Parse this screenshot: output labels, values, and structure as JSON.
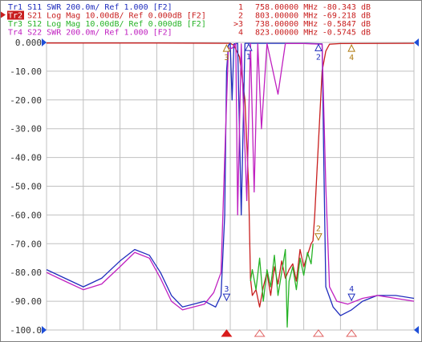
{
  "traces": [
    {
      "label": "Tr1 S11 SWR 200.0m/ Ref 1.000 [F2]",
      "color": "#1f2dbd",
      "active": false
    },
    {
      "label": "Tr2 S21 Log Mag 10.00dB/ Ref 0.000dB [F2]",
      "color": "#c81e1e",
      "active": true
    },
    {
      "label": "Tr3 S12 Log Mag 10.00dB/ Ref 0.000dB [F2]",
      "color": "#27b327",
      "active": false
    },
    {
      "label": "Tr4 S22 SWR 200.0m/ Ref 1.000 [F2]",
      "color": "#c020c0",
      "active": false
    }
  ],
  "marker_table": [
    {
      "id": "1",
      "prefix": "",
      "freq": "758.00000 MHz",
      "value": "-80.343 dB"
    },
    {
      "id": "2",
      "prefix": "",
      "freq": "803.00000 MHz",
      "value": "-69.218 dB"
    },
    {
      "id": "3",
      "prefix": ">",
      "freq": "738.00000 MHz",
      "value": "-0.5847 dB"
    },
    {
      "id": "4",
      "prefix": "",
      "freq": "823.00000 MHz",
      "value": "-0.5745 dB"
    }
  ],
  "colors": {
    "marker_text": "#c81e1e",
    "grid": "#c0c0c0",
    "ref_arrow": "#1f4fd8",
    "stimulus_marker": "#d81b1b",
    "marker_outline": "#e06060"
  },
  "icons": [
    "reference-level-arrow-icon",
    "stimulus-marker-arrow-icon",
    "trace-marker-triangle-icon"
  ],
  "chart_data": {
    "type": "line",
    "ylim": [
      -100,
      0
    ],
    "y_ticks": [
      "0.000",
      "-10.00",
      "-20.00",
      "-30.00",
      "-40.00",
      "-50.00",
      "-60.00",
      "-70.00",
      "-80.00",
      "-90.00",
      "-100.0"
    ],
    "x_divisions": 10,
    "grid": true,
    "legend": "top-left",
    "series": [
      {
        "name": "S21",
        "color": "#c81e1e",
        "points": [
          [
            0,
            -0.2
          ],
          [
            3,
            -0.2
          ],
          [
            5,
            -0.3
          ],
          [
            5.1,
            -1
          ],
          [
            5.25,
            -5
          ],
          [
            5.4,
            -20
          ],
          [
            5.5,
            -50
          ],
          [
            5.55,
            -82
          ],
          [
            5.6,
            -88
          ],
          [
            5.7,
            -86
          ],
          [
            5.8,
            -92
          ],
          [
            5.9,
            -85
          ],
          [
            6,
            -80
          ],
          [
            6.1,
            -88
          ],
          [
            6.2,
            -78
          ],
          [
            6.3,
            -84
          ],
          [
            6.4,
            -76
          ],
          [
            6.5,
            -82
          ],
          [
            6.6,
            -79
          ],
          [
            6.7,
            -77
          ],
          [
            6.8,
            -83
          ],
          [
            6.9,
            -72
          ],
          [
            7,
            -78
          ],
          [
            7.1,
            -74
          ],
          [
            7.2,
            -70
          ],
          [
            7.25,
            -69
          ],
          [
            7.3,
            -60
          ],
          [
            7.4,
            -35
          ],
          [
            7.5,
            -10
          ],
          [
            7.6,
            -3
          ],
          [
            7.7,
            -0.6
          ],
          [
            8,
            -0.4
          ],
          [
            10,
            -0.3
          ]
        ]
      },
      {
        "name": "S12",
        "color": "#27b327",
        "points": [
          [
            5.55,
            -83
          ],
          [
            5.6,
            -79
          ],
          [
            5.7,
            -86
          ],
          [
            5.8,
            -75
          ],
          [
            5.9,
            -90
          ],
          [
            6,
            -79
          ],
          [
            6.1,
            -85
          ],
          [
            6.2,
            -74
          ],
          [
            6.3,
            -88
          ],
          [
            6.4,
            -80
          ],
          [
            6.5,
            -72
          ],
          [
            6.55,
            -99
          ],
          [
            6.6,
            -83
          ],
          [
            6.7,
            -78
          ],
          [
            6.8,
            -86
          ],
          [
            6.9,
            -75
          ],
          [
            7,
            -81
          ],
          [
            7.1,
            -73
          ],
          [
            7.2,
            -77
          ],
          [
            7.25,
            -70
          ]
        ]
      },
      {
        "name": "S11",
        "color": "#1f2dbd",
        "points": [
          [
            0,
            -79
          ],
          [
            0.5,
            -82
          ],
          [
            1,
            -85
          ],
          [
            1.5,
            -82
          ],
          [
            2,
            -76
          ],
          [
            2.4,
            -72
          ],
          [
            2.8,
            -74
          ],
          [
            3.1,
            -80
          ],
          [
            3.4,
            -88
          ],
          [
            3.7,
            -92
          ],
          [
            4,
            -91
          ],
          [
            4.3,
            -90
          ],
          [
            4.6,
            -92
          ],
          [
            4.75,
            -88
          ],
          [
            4.85,
            -60
          ],
          [
            4.9,
            -10
          ],
          [
            4.95,
            -1
          ],
          [
            5,
            -0.3
          ],
          [
            5.05,
            -20
          ],
          [
            5.1,
            -0.5
          ],
          [
            5.2,
            -0.3
          ],
          [
            5.3,
            -60
          ],
          [
            5.4,
            -0.3
          ],
          [
            7,
            -0.3
          ],
          [
            7.5,
            -0.5
          ],
          [
            7.55,
            -45
          ],
          [
            7.6,
            -85
          ],
          [
            7.8,
            -92
          ],
          [
            8,
            -95
          ],
          [
            8.3,
            -93
          ],
          [
            8.6,
            -90
          ],
          [
            9,
            -88
          ],
          [
            9.5,
            -88
          ],
          [
            10,
            -89
          ]
        ]
      },
      {
        "name": "S22",
        "color": "#c020c0",
        "points": [
          [
            0,
            -80
          ],
          [
            0.5,
            -83
          ],
          [
            1,
            -86
          ],
          [
            1.5,
            -84
          ],
          [
            2,
            -78
          ],
          [
            2.4,
            -73
          ],
          [
            2.8,
            -75
          ],
          [
            3.1,
            -82
          ],
          [
            3.4,
            -90
          ],
          [
            3.7,
            -93
          ],
          [
            4,
            -92
          ],
          [
            4.3,
            -91
          ],
          [
            4.55,
            -87
          ],
          [
            4.75,
            -80
          ],
          [
            4.85,
            -40
          ],
          [
            4.95,
            -2
          ],
          [
            5.05,
            -2
          ],
          [
            5.15,
            -0.4
          ],
          [
            5.2,
            -60
          ],
          [
            5.3,
            -0.5
          ],
          [
            5.45,
            -55
          ],
          [
            5.55,
            -0.4
          ],
          [
            5.65,
            -52
          ],
          [
            5.75,
            -0.5
          ],
          [
            5.85,
            -30
          ],
          [
            6,
            -0.4
          ],
          [
            6.3,
            -18
          ],
          [
            6.5,
            -0.4
          ],
          [
            7,
            -0.4
          ],
          [
            7.5,
            -0.6
          ],
          [
            7.6,
            -50
          ],
          [
            7.7,
            -85
          ],
          [
            7.9,
            -90
          ],
          [
            8.2,
            -91
          ],
          [
            8.6,
            -89
          ],
          [
            9,
            -88
          ],
          [
            9.5,
            -89
          ],
          [
            10,
            -90
          ]
        ]
      }
    ],
    "markers": [
      {
        "id": "1",
        "x": 5.5,
        "y": -0.3,
        "side": "top",
        "color": "#1f2dbd"
      },
      {
        "id": "2",
        "x": 7.4,
        "y": -0.4,
        "side": "top",
        "color": "#1f2dbd"
      },
      {
        "id": "3",
        "x": 4.9,
        "y": -0.6,
        "side": "top",
        "color": "#b07a10"
      },
      {
        "id": "4",
        "x": 8.3,
        "y": -0.6,
        "side": "top",
        "color": "#b07a10"
      },
      {
        "id": "3",
        "x": 4.9,
        "y": -90,
        "side": "bottom",
        "color": "#1f2dbd"
      },
      {
        "id": "4",
        "x": 8.3,
        "y": -90,
        "side": "bottom",
        "color": "#1f2dbd"
      },
      {
        "id": "2",
        "x": 7.4,
        "y": -69,
        "side": "bottom",
        "color": "#b07a10"
      }
    ],
    "stimulus_markers": [
      {
        "x": 4.9,
        "active": true
      },
      {
        "x": 5.8,
        "active": false
      },
      {
        "x": 7.4,
        "active": false
      },
      {
        "x": 8.3,
        "active": false
      }
    ]
  }
}
